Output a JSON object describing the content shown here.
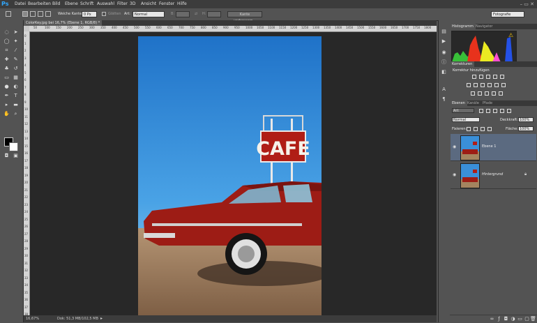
{
  "app": {
    "logo": "Ps"
  },
  "menu": [
    "Datei",
    "Bearbeiten",
    "Bild",
    "Ebene",
    "Schrift",
    "Auswahl",
    "Filter",
    "3D",
    "Ansicht",
    "Fenster",
    "Hilfe"
  ],
  "window_controls": "–  ▭  ✕",
  "options": {
    "feather_label": "Weiche Kante:",
    "feather_value": "0 Px",
    "smooth_label": "Glätten",
    "style_label": "Art:",
    "style_value": "Normal",
    "width_label": "B:",
    "height_label": "H:",
    "refine_button": "Kante verbessern...",
    "workspace": "Fotografie"
  },
  "document": {
    "tab_title": "ColorKey.jpg bei 16,7% (Ebene 1, RGB/8) *",
    "close": "×",
    "ruler_ticks_top": [
      "50",
      "100",
      "150",
      "200",
      "250",
      "300",
      "350",
      "400",
      "450",
      "500",
      "550",
      "600",
      "650",
      "700",
      "750",
      "800",
      "850",
      "900",
      "950",
      "1000",
      "1050",
      "1100",
      "1150",
      "1200",
      "1250",
      "1300",
      "1350",
      "1400",
      "1450",
      "1500",
      "1550",
      "1600",
      "1650",
      "1700",
      "1750",
      "1800"
    ],
    "ruler_ticks_left": [
      "0",
      "1",
      "2",
      "3",
      "4",
      "5",
      "6",
      "7",
      "8",
      "9",
      "10",
      "11",
      "12",
      "13",
      "14",
      "15",
      "16",
      "17",
      "18",
      "19",
      "20",
      "21",
      "22",
      "23",
      "24",
      "25",
      "26",
      "27",
      "28",
      "29",
      "30",
      "31",
      "32",
      "33",
      "34",
      "35",
      "36",
      "37",
      "38"
    ],
    "sign_text": "CAFE"
  },
  "status": {
    "zoom": "16,67%",
    "doc_size": "Dok: 51,3 MB/102,5 MB"
  },
  "panels": {
    "histogram_tab": "Histogramm",
    "navigator_tab": "Navigator",
    "corrections_tab": "Korrekturen",
    "corrections_title": "Korrektur hinzufügen",
    "layers_tab": "Ebenen",
    "channels_tab": "Kanäle",
    "paths_tab": "Pfade",
    "filter_kind": "Art",
    "blend_mode": "Normal",
    "opacity_label": "Deckkraft:",
    "opacity_value": "100%",
    "lock_label": "Fixieren:",
    "fill_label": "Fläche:",
    "fill_value": "100%",
    "layers": [
      {
        "name": "Ebene 1",
        "selected": true
      },
      {
        "name": "Hintergrund",
        "selected": false
      }
    ]
  },
  "colors": {
    "accent": "#31a8ff",
    "panel": "#535353",
    "dark": "#282828",
    "selected_layer": "#5b6a80"
  }
}
